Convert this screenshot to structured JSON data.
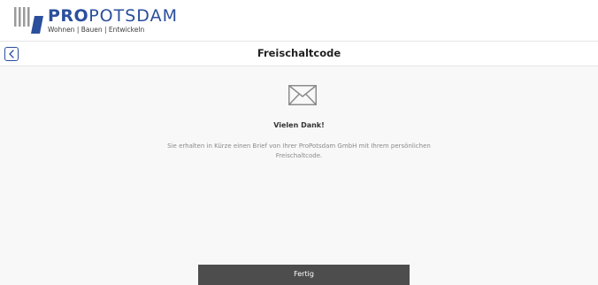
{
  "header": {
    "logo": {
      "brand_bold": "PRO",
      "brand_rest": "POTSDAM",
      "tagline": "Wohnen | Bauen | Entwickeln"
    }
  },
  "titlebar": {
    "title": "Freischaltcode",
    "back_icon": "chevron-left-icon"
  },
  "content": {
    "icon": "envelope-icon",
    "heading": "Vielen Dank!",
    "message": "Sie erhalten in Kürze einen Brief von Ihrer ProPotsdam GmbH mit Ihrem persönlichen Freischaltcode.",
    "done_label": "Fertig"
  },
  "colors": {
    "brand": "#2b4f9c",
    "background": "#f8f8f8",
    "button": "#4d4d4d",
    "button_text": "#ffffff"
  }
}
